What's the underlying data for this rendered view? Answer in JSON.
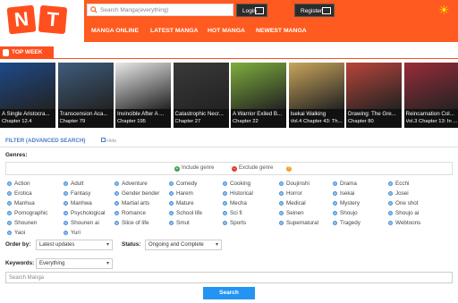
{
  "logo": {
    "letters": [
      "N",
      "T"
    ]
  },
  "header": {
    "search_placeholder": "Search Manga(everything)",
    "login_label": "Login",
    "register_label": "Register"
  },
  "nav": {
    "items": [
      "MANGA ONLINE",
      "LATEST MANGA",
      "HOT MANGA",
      "NEWEST MANGA"
    ]
  },
  "topweek": {
    "label": "TOP WEEK"
  },
  "covers": [
    {
      "title": "A Single Aristocra...",
      "chapter": "Chapter 12.4",
      "color": "#1e4a8a"
    },
    {
      "title": "Transcension Aca...",
      "chapter": "Chapter 79",
      "color": "#3f5d7d"
    },
    {
      "title": "Invincible After A ...",
      "chapter": "Chapter 195",
      "color": "#e8e8e8"
    },
    {
      "title": "Catastrophic Necr...",
      "chapter": "Chapter 27",
      "color": "#3a3a3a"
    },
    {
      "title": "A Warrior Exiled B...",
      "chapter": "Chapter 22",
      "color": "#7fae3d"
    },
    {
      "title": "Isekai Walking",
      "chapter": "Vol.4 Chapter 43: Th...",
      "color": "#c9a55c"
    },
    {
      "title": "Drawing: The Gre...",
      "chapter": "Chapter 80",
      "color": "#b8453a"
    },
    {
      "title": "Reincarnation Col...",
      "chapter": "Vol.3 Chapter 13: In ...",
      "color": "#9a2c3a"
    }
  ],
  "filter": {
    "title": "FILTER (ADVANCED SEARCH)",
    "hide_label": "Hide",
    "genres_label": "Genres:",
    "include_label": "Include genre",
    "exclude_label": "Exclude genre",
    "help_symbol": "?",
    "genres": [
      [
        "Action",
        "Adult",
        "Adventure",
        "Comedy",
        "Cooking",
        "Doujinshi",
        "Drama",
        "Ecchi"
      ],
      [
        "Erotica",
        "Fantasy",
        "Gender bender",
        "Harem",
        "Historical",
        "Horror",
        "Isekai",
        "Josei"
      ],
      [
        "Manhua",
        "Manhwa",
        "Martial arts",
        "Mature",
        "Mecha",
        "Medical",
        "Mystery",
        "One shot"
      ],
      [
        "Pornographic",
        "Psychological",
        "Romance",
        "School life",
        "Sci fi",
        "Seinen",
        "Shoujo",
        "Shoujo ai"
      ],
      [
        "Shounen",
        "Shounen ai",
        "Slice of life",
        "Smut",
        "Sports",
        "Supernatural",
        "Tragedy",
        "Webtoons"
      ],
      [
        "Yaoi",
        "Yuri"
      ]
    ],
    "order_label": "Order by:",
    "order_value": "Latest updates",
    "status_label": "Status:",
    "status_value": "Ongoing and Complete",
    "keywords_label": "Keywords:",
    "keywords_value": "Everything",
    "search_placeholder": "Search Manga",
    "search_button": "Search"
  },
  "colors": {
    "brand": "#ff5a1f",
    "link": "#4a7cc7",
    "button": "#2494f2"
  }
}
